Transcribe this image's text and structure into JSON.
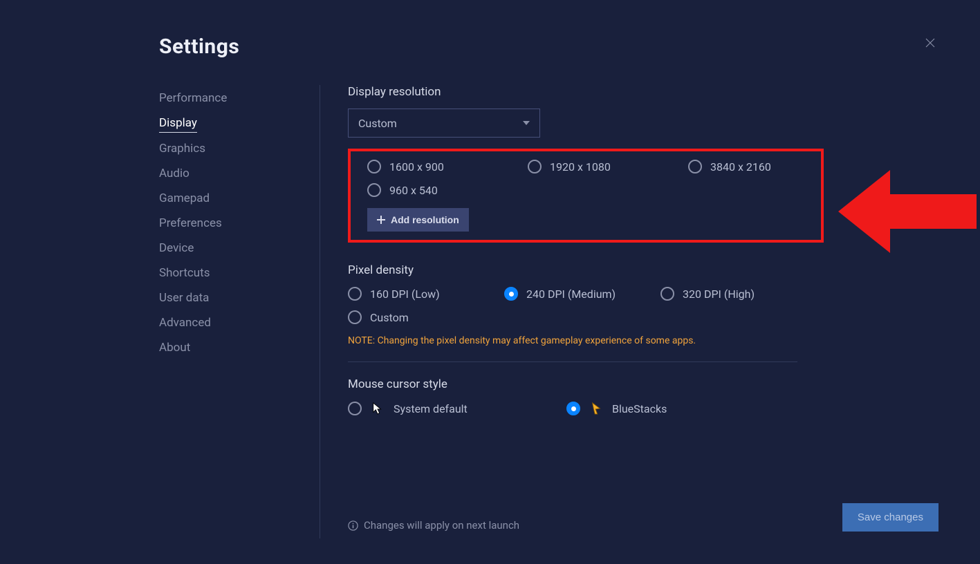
{
  "title": "Settings",
  "sidebar": {
    "items": [
      {
        "label": "Performance"
      },
      {
        "label": "Display"
      },
      {
        "label": "Graphics"
      },
      {
        "label": "Audio"
      },
      {
        "label": "Gamepad"
      },
      {
        "label": "Preferences"
      },
      {
        "label": "Device"
      },
      {
        "label": "Shortcuts"
      },
      {
        "label": "User data"
      },
      {
        "label": "Advanced"
      },
      {
        "label": "About"
      }
    ],
    "active_index": 1
  },
  "display": {
    "resolution_label": "Display resolution",
    "select_value": "Custom",
    "options": [
      {
        "label": "1600 x 900",
        "checked": false
      },
      {
        "label": "1920 x 1080",
        "checked": false
      },
      {
        "label": "3840 x 2160",
        "checked": false
      },
      {
        "label": "960 x 540",
        "checked": false
      }
    ],
    "add_resolution": "Add resolution"
  },
  "density": {
    "label": "Pixel density",
    "options": [
      {
        "label": "160 DPI (Low)",
        "checked": false
      },
      {
        "label": "240 DPI (Medium)",
        "checked": true
      },
      {
        "label": "320 DPI (High)",
        "checked": false
      },
      {
        "label": "Custom",
        "checked": false
      }
    ],
    "note": "NOTE: Changing the pixel density may affect gameplay experience of some apps."
  },
  "cursor": {
    "label": "Mouse cursor style",
    "options": [
      {
        "label": "System default",
        "checked": false,
        "icon": "system"
      },
      {
        "label": "BlueStacks",
        "checked": true,
        "icon": "bluestacks"
      }
    ]
  },
  "footer": {
    "info": "Changes will apply on next launch",
    "save": "Save changes"
  }
}
